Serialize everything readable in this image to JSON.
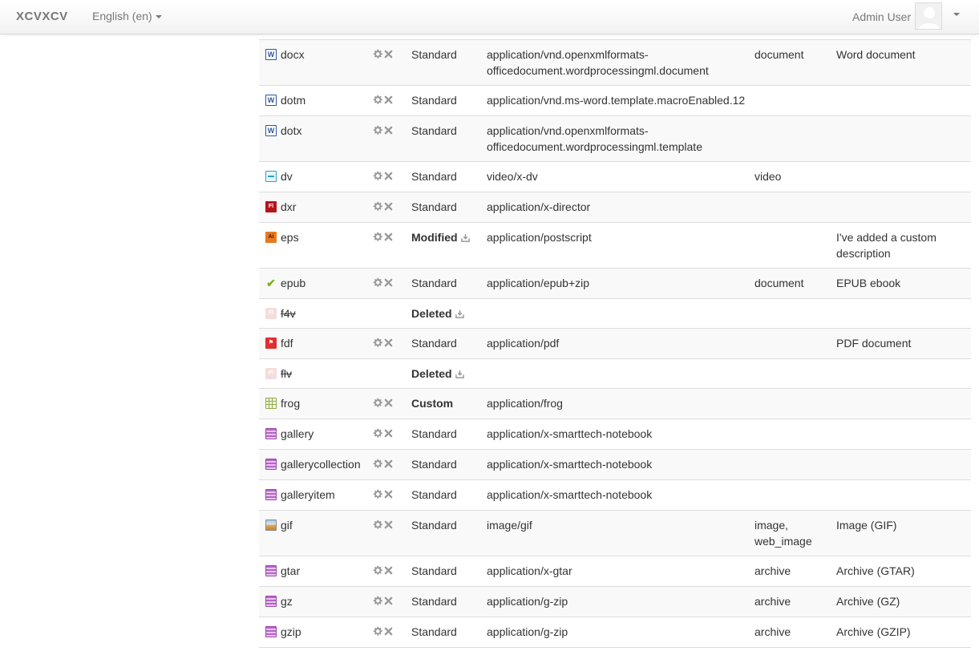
{
  "navbar": {
    "brand": "XCVXCV",
    "language": "English (en)",
    "user": "Admin User"
  },
  "icons": {
    "settings": "gear-icon",
    "delete": "close-icon",
    "revert": "download-icon"
  },
  "rows": [
    {
      "ext": "docx",
      "icon": "word",
      "status": "Standard",
      "mime": "application/vnd.openxmlformats-officedocument.wordprocessingml.document",
      "groups": "document",
      "desc": "Word document"
    },
    {
      "ext": "dotm",
      "icon": "word",
      "status": "Standard",
      "mime": "application/vnd.ms-word.template.macroEnabled.12",
      "groups": "",
      "desc": ""
    },
    {
      "ext": "dotx",
      "icon": "word",
      "status": "Standard",
      "mime": "application/vnd.openxmlformats-officedocument.wordprocessingml.template",
      "groups": "",
      "desc": ""
    },
    {
      "ext": "dv",
      "icon": "video",
      "status": "Standard",
      "mime": "video/x-dv",
      "groups": "video",
      "desc": ""
    },
    {
      "ext": "dxr",
      "icon": "flash",
      "status": "Standard",
      "mime": "application/x-director",
      "groups": "",
      "desc": ""
    },
    {
      "ext": "eps",
      "icon": "ai",
      "status": "Modified",
      "mime": "application/postscript",
      "groups": "",
      "desc": "I've added a custom description"
    },
    {
      "ext": "epub",
      "icon": "epub",
      "status": "Standard",
      "mime": "application/epub+zip",
      "groups": "document",
      "desc": "EPUB ebook"
    },
    {
      "ext": "f4v",
      "icon": "ghost",
      "status": "Deleted",
      "mime": "",
      "groups": "",
      "desc": ""
    },
    {
      "ext": "fdf",
      "icon": "pdf",
      "status": "Standard",
      "mime": "application/pdf",
      "groups": "",
      "desc": "PDF document"
    },
    {
      "ext": "flv",
      "icon": "ghost",
      "status": "Deleted",
      "mime": "",
      "groups": "",
      "desc": ""
    },
    {
      "ext": "frog",
      "icon": "sheet",
      "status": "Custom",
      "mime": "application/frog",
      "groups": "",
      "desc": ""
    },
    {
      "ext": "gallery",
      "icon": "archive",
      "status": "Standard",
      "mime": "application/x-smarttech-notebook",
      "groups": "",
      "desc": ""
    },
    {
      "ext": "gallerycollection",
      "icon": "archive",
      "status": "Standard",
      "mime": "application/x-smarttech-notebook",
      "groups": "",
      "desc": ""
    },
    {
      "ext": "galleryitem",
      "icon": "archive",
      "status": "Standard",
      "mime": "application/x-smarttech-notebook",
      "groups": "",
      "desc": ""
    },
    {
      "ext": "gif",
      "icon": "image",
      "status": "Standard",
      "mime": "image/gif",
      "groups": "image, web_image",
      "desc": "Image (GIF)"
    },
    {
      "ext": "gtar",
      "icon": "archive",
      "status": "Standard",
      "mime": "application/x-gtar",
      "groups": "archive",
      "desc": "Archive (GTAR)"
    },
    {
      "ext": "gz",
      "icon": "archive",
      "status": "Standard",
      "mime": "application/g-zip",
      "groups": "archive",
      "desc": "Archive (GZ)"
    },
    {
      "ext": "gzip",
      "icon": "archive",
      "status": "Standard",
      "mime": "application/g-zip",
      "groups": "archive",
      "desc": "Archive (GZIP)"
    }
  ]
}
